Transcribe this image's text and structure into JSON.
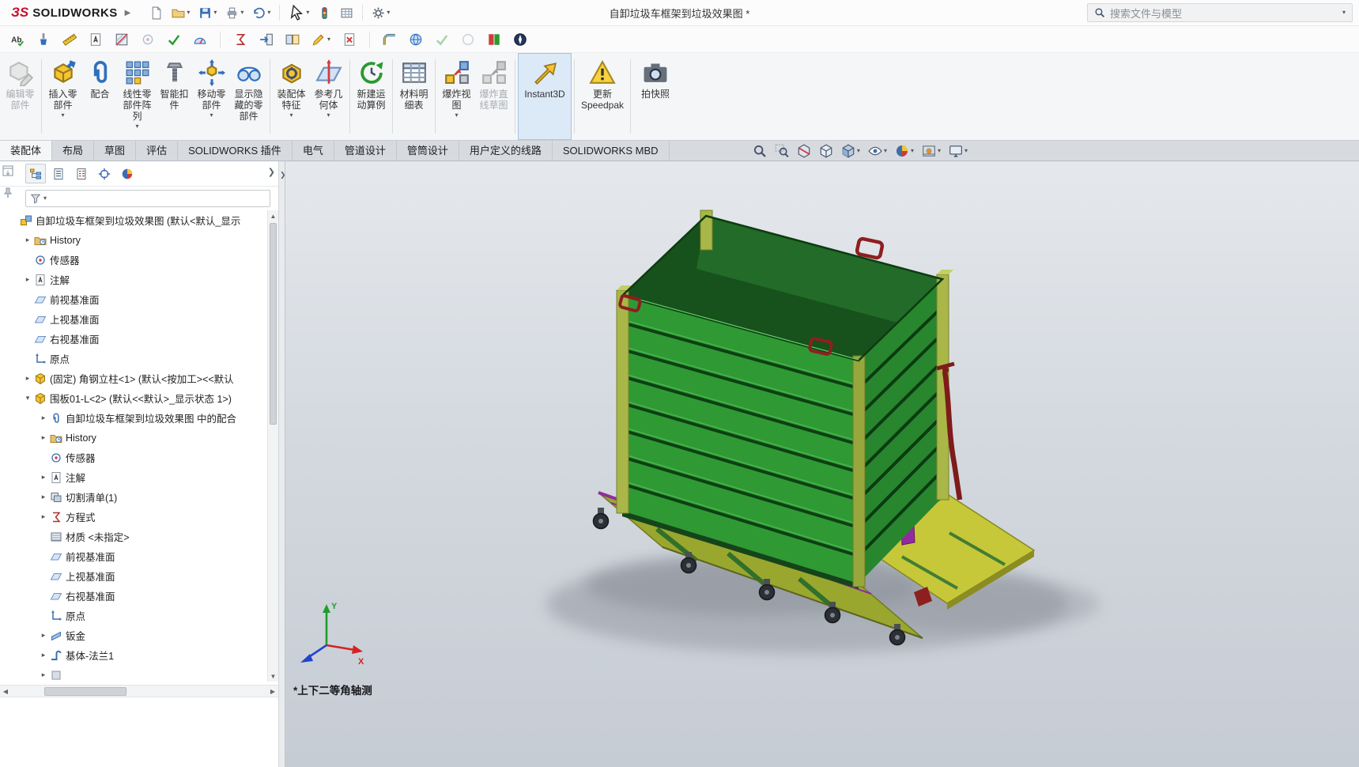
{
  "titlebar": {
    "brand": "SOLIDWORKS",
    "title": "自卸垃圾车框架到垃圾效果图 *",
    "search_placeholder": "搜索文件与模型"
  },
  "quick_toolbar_icons": [
    "new-file",
    "open-file",
    "save",
    "print",
    "undo",
    "select-cursor",
    "selection-filter",
    "file-properties",
    "options-gear"
  ],
  "toolbar2_icons": [
    "spell-check",
    "format-painter",
    "measure",
    "comment",
    "section-properties",
    "sensor",
    "check-entity",
    "performance-evaluation",
    "equations",
    "import",
    "compare-documents",
    "sketch",
    "cancel",
    "routing",
    "web",
    "verify",
    "reference-circle",
    "pmi-flag",
    "motion-compass"
  ],
  "ribbon": {
    "buttons": [
      {
        "label": "编辑零\n部件",
        "state": "disabled"
      },
      {
        "label": "插入零\n部件",
        "caret": true
      },
      {
        "label": "配合"
      },
      {
        "label": "线性零\n部件阵\n列",
        "caret": true
      },
      {
        "label": "智能扣\n件"
      },
      {
        "label": "移动零\n部件",
        "caret": true
      },
      {
        "label": "显示隐\n藏的零\n部件"
      },
      {
        "label": "装配体\n特征",
        "caret": true
      },
      {
        "label": "参考几\n何体",
        "caret": true
      },
      {
        "label": "新建运\n动算例"
      },
      {
        "label": "材料明\n细表"
      },
      {
        "label": "爆炸视\n图",
        "caret": true
      },
      {
        "label": "爆炸直\n线草图",
        "state": "disabled"
      },
      {
        "label": "Instant3D",
        "state": "active"
      },
      {
        "label": "更新\nSpeedpak"
      },
      {
        "label": "拍快照"
      }
    ]
  },
  "tabs": [
    {
      "label": "装配体",
      "active": true
    },
    {
      "label": "布局"
    },
    {
      "label": "草图"
    },
    {
      "label": "评估"
    },
    {
      "label": "SOLIDWORKS 插件"
    },
    {
      "label": "电气"
    },
    {
      "label": "管道设计"
    },
    {
      "label": "管筒设计"
    },
    {
      "label": "用户定义的线路"
    },
    {
      "label": "SOLIDWORKS MBD"
    }
  ],
  "headsup_icons": [
    "zoom-to-fit",
    "zoom-to-area",
    "section-view",
    "view-orientation",
    "display-style",
    "hide-show-items",
    "edit-appearance",
    "apply-scene",
    "view-settings"
  ],
  "panel": {
    "tabs": [
      "featuremanager-design-tree",
      "propertymanager",
      "configurationmanager",
      "dimxpertmanager",
      "displaymanager"
    ],
    "tree": [
      {
        "label": "自卸垃圾车框架到垃圾效果图 (默认<默认_显示",
        "icon": "assembly",
        "level": 0,
        "expand": "none"
      },
      {
        "label": "History",
        "icon": "history",
        "level": 1,
        "expand": "collapsed"
      },
      {
        "label": "传感器",
        "icon": "sensors",
        "level": 1,
        "expand": "none"
      },
      {
        "label": "注解",
        "icon": "annotations",
        "level": 1,
        "expand": "collapsed"
      },
      {
        "label": "前视基准面",
        "icon": "plane",
        "level": 1,
        "expand": "none"
      },
      {
        "label": "上视基准面",
        "icon": "plane",
        "level": 1,
        "expand": "none"
      },
      {
        "label": "右视基准面",
        "icon": "plane",
        "level": 1,
        "expand": "none"
      },
      {
        "label": "原点",
        "icon": "origin",
        "level": 1,
        "expand": "none"
      },
      {
        "label": "(固定) 角钢立柱<1> (默认<按加工><<默认",
        "icon": "part",
        "level": 1,
        "expand": "collapsed"
      },
      {
        "label": "围板01-L<2> (默认<<默认>_显示状态 1>)",
        "icon": "part",
        "level": 1,
        "expand": "expanded"
      },
      {
        "label": "自卸垃圾车框架到垃圾效果图 中的配合",
        "icon": "mates",
        "level": 2,
        "expand": "collapsed"
      },
      {
        "label": "History",
        "icon": "history",
        "level": 2,
        "expand": "collapsed"
      },
      {
        "label": "传感器",
        "icon": "sensors",
        "level": 2,
        "expand": "none"
      },
      {
        "label": "注解",
        "icon": "annotations",
        "level": 2,
        "expand": "collapsed"
      },
      {
        "label": "切割清单(1)",
        "icon": "cut-list",
        "level": 2,
        "expand": "collapsed"
      },
      {
        "label": "方程式",
        "icon": "equations",
        "level": 2,
        "expand": "collapsed"
      },
      {
        "label": "材质 <未指定>",
        "icon": "material",
        "level": 2,
        "expand": "none"
      },
      {
        "label": "前视基准面",
        "icon": "plane",
        "level": 2,
        "expand": "none"
      },
      {
        "label": "上视基准面",
        "icon": "plane",
        "level": 2,
        "expand": "none"
      },
      {
        "label": "右视基准面",
        "icon": "plane",
        "level": 2,
        "expand": "none"
      },
      {
        "label": "原点",
        "icon": "origin",
        "level": 2,
        "expand": "none"
      },
      {
        "label": "钣金",
        "icon": "sheet-metal",
        "level": 2,
        "expand": "collapsed"
      },
      {
        "label": "基体-法兰1",
        "icon": "base-flange",
        "level": 2,
        "expand": "collapsed"
      },
      {
        "label": "",
        "icon": "feature",
        "level": 2,
        "expand": "collapsed"
      }
    ]
  },
  "viewport": {
    "view_name": "*上下二等角轴测"
  },
  "colors": {
    "box_green": "#2f9a34",
    "box_green_dark": "#28862e",
    "post_green": "#a9b748",
    "plate_yellow": "#c6c839",
    "base_olive": "#9aa72e",
    "handle_red": "#8e1f1f",
    "accent_purple": "#93299f",
    "viewport_top": "#e5e8ec",
    "viewport_bottom": "#c6ccd4"
  }
}
